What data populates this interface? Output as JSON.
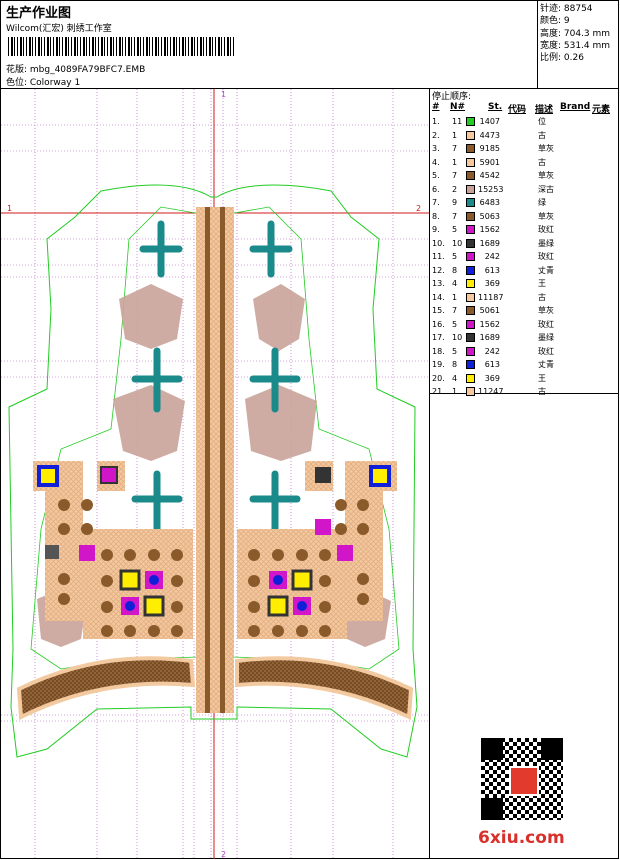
{
  "header": {
    "title": "生产作业图",
    "subtitle": "Wilcom(汇宏) 刺绣工作室",
    "design_label": "花版: mbg_4089FA79BFC7.EMB",
    "colorway_label": "色位: Colorway 1"
  },
  "stats": [
    "针迹: 88754",
    "颜色: 9",
    "高度: 704.3 mm",
    "宽度: 531.4 mm",
    "比例: 0.26"
  ],
  "legend": {
    "title": "停止顺序:",
    "columns": [
      "#",
      "N#",
      "St.",
      "代码",
      "描述",
      "Brand",
      "元素"
    ],
    "rows": [
      {
        "idx": "1.",
        "n": "11",
        "color": "#22cc22",
        "st": "1407",
        "desc": "位"
      },
      {
        "idx": "2.",
        "n": "1",
        "color": "#f5c89e",
        "st": "4473",
        "desc": "古"
      },
      {
        "idx": "3.",
        "n": "7",
        "color": "#8b5a2b",
        "st": "9185",
        "desc": "草灰"
      },
      {
        "idx": "4.",
        "n": "1",
        "color": "#f5c89e",
        "st": "5901",
        "desc": "古"
      },
      {
        "idx": "5.",
        "n": "7",
        "color": "#8b5a2b",
        "st": "4542",
        "desc": "草灰"
      },
      {
        "idx": "6.",
        "n": "2",
        "color": "#c9a39a",
        "st": "15253",
        "desc": "深古"
      },
      {
        "idx": "7.",
        "n": "9",
        "color": "#1a8a8a",
        "st": "6483",
        "desc": "绿"
      },
      {
        "idx": "8.",
        "n": "7",
        "color": "#8b5a2b",
        "st": "5063",
        "desc": "草灰"
      },
      {
        "idx": "9.",
        "n": "5",
        "color": "#d016c8",
        "st": "1562",
        "desc": "玫红"
      },
      {
        "idx": "10.",
        "n": "10",
        "color": "#333333",
        "st": "1689",
        "desc": "墨绿"
      },
      {
        "idx": "11.",
        "n": "5",
        "color": "#d016c8",
        "st": "242",
        "desc": "玫红"
      },
      {
        "idx": "12.",
        "n": "8",
        "color": "#1020d8",
        "st": "613",
        "desc": "丈青"
      },
      {
        "idx": "13.",
        "n": "4",
        "color": "#ffee00",
        "st": "369",
        "desc": "王"
      },
      {
        "idx": "14.",
        "n": "1",
        "color": "#f5c89e",
        "st": "11187",
        "desc": "古"
      },
      {
        "idx": "15.",
        "n": "7",
        "color": "#8b5a2b",
        "st": "5061",
        "desc": "草灰"
      },
      {
        "idx": "16.",
        "n": "5",
        "color": "#d016c8",
        "st": "1562",
        "desc": "玫红"
      },
      {
        "idx": "17.",
        "n": "10",
        "color": "#333333",
        "st": "1689",
        "desc": "墨绿"
      },
      {
        "idx": "18.",
        "n": "5",
        "color": "#d016c8",
        "st": "242",
        "desc": "玫红"
      },
      {
        "idx": "19.",
        "n": "8",
        "color": "#1020d8",
        "st": "613",
        "desc": "丈青"
      },
      {
        "idx": "20.",
        "n": "4",
        "color": "#ffee00",
        "st": "369",
        "desc": "王"
      },
      {
        "idx": "21.",
        "n": "1",
        "color": "#f5c89e",
        "st": "11247",
        "desc": "古"
      }
    ]
  },
  "canvas": {
    "guide_top": "1",
    "guide_bottom": "2",
    "guide_left": "1",
    "guide_right": "2"
  },
  "watermark": "6xiu.com"
}
